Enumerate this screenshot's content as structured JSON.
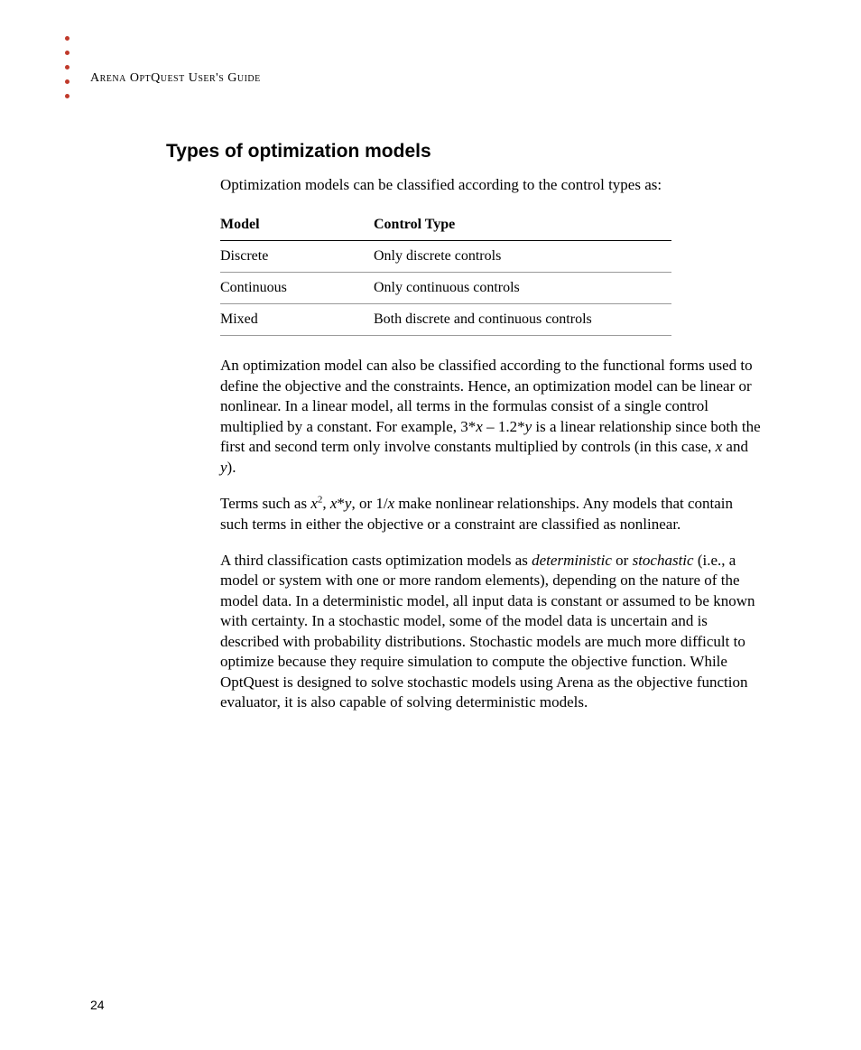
{
  "header": {
    "running_head": "Arena OptQuest User's Guide"
  },
  "section": {
    "heading": "Types of optimization models",
    "intro": "Optimization models can be classified according to the control types as:"
  },
  "table": {
    "headers": {
      "col1": "Model",
      "col2": "Control Type"
    },
    "rows": [
      {
        "model": "Discrete",
        "control": "Only discrete controls"
      },
      {
        "model": "Continuous",
        "control": "Only continuous controls"
      },
      {
        "model": "Mixed",
        "control": "Both discrete and continuous controls"
      }
    ]
  },
  "paragraphs": {
    "p1": {
      "t1": "An optimization model can also be classified according to the functional forms used to define the objective and the constraints. Hence, an optimization model can be linear or nonlinear. In a linear model, all terms in the formulas consist of a single control multiplied by a constant. For example, 3*",
      "x1": "x",
      "t2": " – 1.2*",
      "y1": "y",
      "t3": " is a linear relationship since both the first and second term only involve constants multiplied by controls (in this case, ",
      "x2": "x",
      "t4": " and ",
      "y2": "y",
      "t5": ")."
    },
    "p2": {
      "t1": "Terms such as ",
      "x1": "x",
      "sup": "2",
      "t2": ", ",
      "x2": "x",
      "t3": "*",
      "y1": "y",
      "t4": ", or 1/",
      "x3": "x",
      "t5": " make nonlinear relationships. Any models that contain such terms in either the objective or a constraint are classified as nonlinear."
    },
    "p3": {
      "t1": "A third classification casts optimization models as ",
      "det": "deterministic",
      "t2": " or ",
      "sto": "stochastic",
      "t3": " (i.e., a model or system with one or more random elements), depending on the nature of the model data. In a deterministic model, all input data is constant or assumed to be known with certainty. In a stochastic model, some of the model data is uncertain and is described with probability distributions. Stochastic models are much more difficult to optimize because they require simulation to compute the objective function. While OptQuest is designed to solve stochastic models using Arena as the objective function evaluator, it is also capable of solving deterministic models."
    }
  },
  "page_number": "24"
}
